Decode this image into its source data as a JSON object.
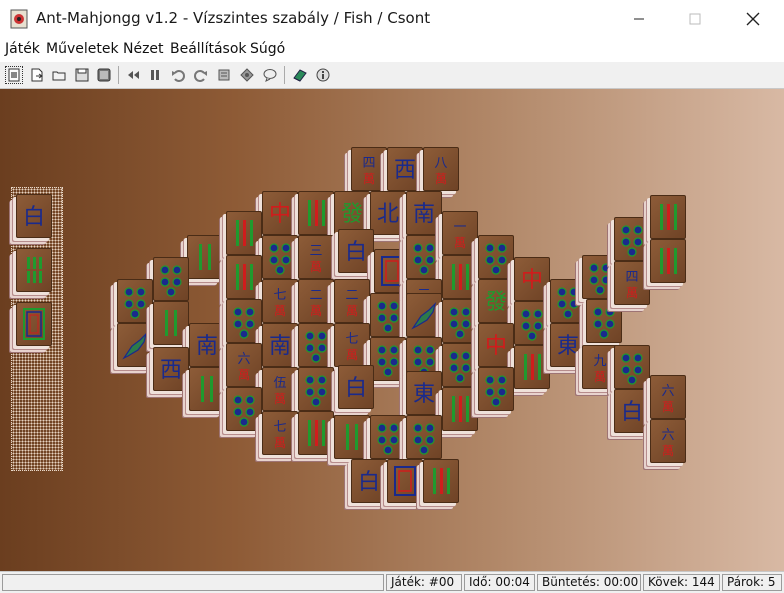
{
  "window": {
    "title": "Ant-Mahjongg v1.2 - Vízszintes szabály / Fish / Csont",
    "app_icon": "mahjong-app-icon",
    "controls": [
      "minimize-icon",
      "maximize-icon",
      "close-icon"
    ]
  },
  "menu": [
    "Játék",
    "Műveletek",
    "Nézet",
    "Beállítások",
    "Súgó"
  ],
  "toolbar": {
    "buttons": [
      "new-game-icon",
      "open-icon",
      "folder-icon",
      "save-icon",
      "save-as-icon",
      "rewind-icon",
      "pause-icon",
      "undo-icon",
      "redo-icon",
      "hint-icon",
      "shuffle-icon",
      "chat-icon",
      "rules-book-icon",
      "about-icon"
    ]
  },
  "tray": [
    {
      "glyph": "白",
      "kind": "dragon-white"
    },
    {
      "glyph": "",
      "kind": "bamboo"
    },
    {
      "glyph": "",
      "kind": "frame"
    }
  ],
  "tiles": [
    {
      "glyph": "四",
      "sub": "萬"
    },
    {
      "glyph": "西",
      "sub": ""
    },
    {
      "glyph": "八",
      "sub": "萬"
    },
    {
      "glyph": "中",
      "sub": ""
    },
    {
      "glyph": "發",
      "sub": ""
    },
    {
      "glyph": "北",
      "sub": ""
    },
    {
      "glyph": "南",
      "sub": ""
    },
    {
      "glyph": "白",
      "sub": ""
    },
    {
      "glyph": "三",
      "sub": "萬"
    },
    {
      "glyph": "七",
      "sub": "萬"
    },
    {
      "glyph": "二",
      "sub": "萬"
    },
    {
      "glyph": "南",
      "sub": ""
    },
    {
      "glyph": "西",
      "sub": ""
    },
    {
      "glyph": "六",
      "sub": "萬"
    },
    {
      "glyph": "伍",
      "sub": "萬"
    },
    {
      "glyph": "東",
      "sub": ""
    },
    {
      "glyph": "中",
      "sub": ""
    },
    {
      "glyph": "發",
      "sub": ""
    },
    {
      "glyph": "東",
      "sub": ""
    },
    {
      "glyph": "九",
      "sub": "萬"
    },
    {
      "glyph": "白",
      "sub": ""
    },
    {
      "glyph": "六",
      "sub": "萬"
    },
    {
      "glyph": "六",
      "sub": "萬"
    },
    {
      "glyph": "白",
      "sub": ""
    },
    {
      "glyph": "一",
      "sub": "萬"
    },
    {
      "glyph": "四",
      "sub": "萬"
    }
  ],
  "status": {
    "game": "Játék: #00",
    "time": "Idő: 00:04",
    "penalty": "Büntetés: 00:00",
    "stones": "Kövek: 144",
    "pairs": "Párok: 5"
  },
  "colors": {
    "board_left": "#6b3e1f",
    "board_right": "#d8b9a4",
    "tile_face": "#7d4e2d",
    "red_glyph": "#d01c1c",
    "blue_glyph": "#1a2a8c",
    "green_glyph": "#1f9a2e"
  }
}
